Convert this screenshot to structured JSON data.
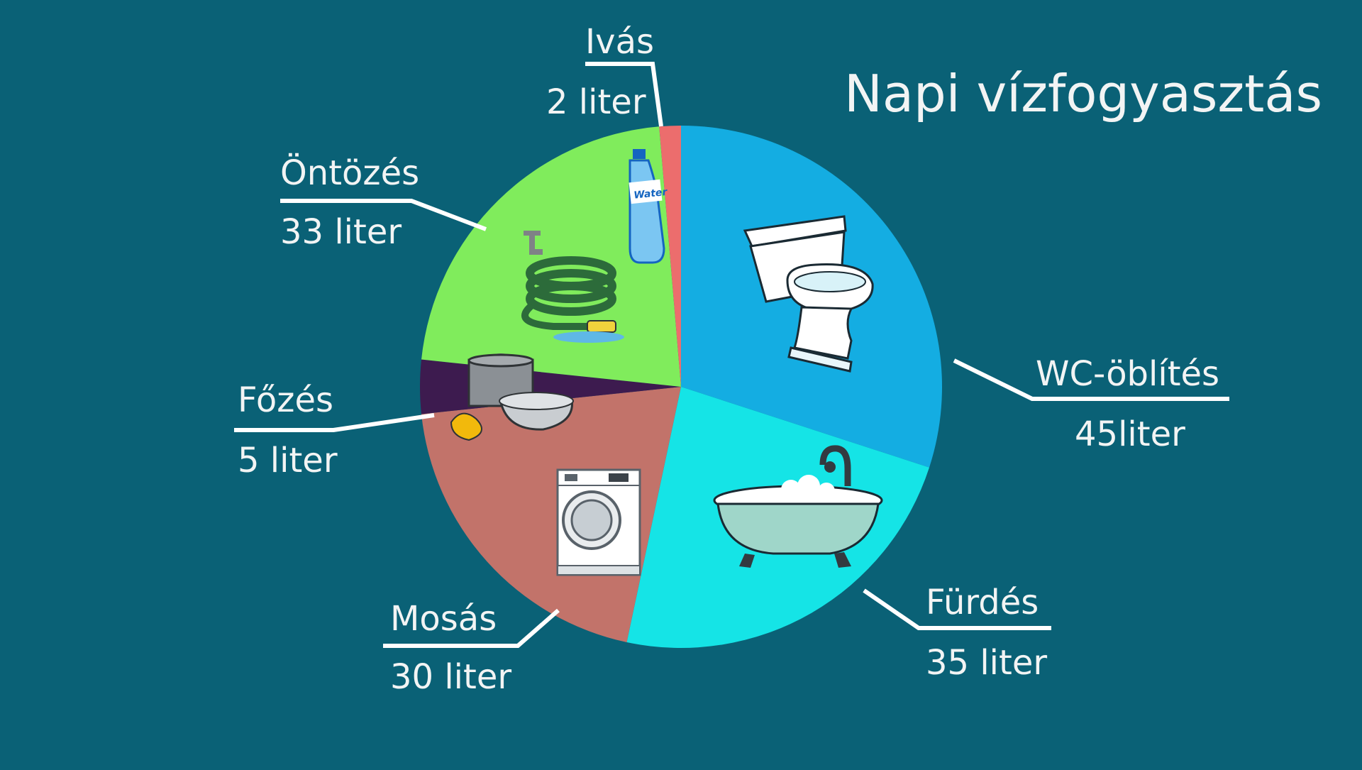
{
  "colors": {
    "background": "#0a6176",
    "text": "#f2f4f4",
    "leader": "#ffffff"
  },
  "title": "Napi vízfogyasztás",
  "chart_data": {
    "type": "pie",
    "title": "Napi vízfogyasztás",
    "start": "12 o'clock",
    "direction": "clockwise",
    "slices": [
      {
        "label": "WC-öblítés",
        "value_label": "45liter",
        "value": 45,
        "color": "#14ade2",
        "icon": "toilet-icon"
      },
      {
        "label": "Fürdés",
        "value_label": "35 liter",
        "value": 35,
        "color": "#15e4e6",
        "icon": "bathtub-icon"
      },
      {
        "label": "Mosás",
        "value_label": "30 liter",
        "value": 30,
        "color": "#c2736a",
        "icon": "washing-machine-icon"
      },
      {
        "label": "Főzés",
        "value_label": "5 liter",
        "value": 5,
        "color": "#3d1b4f",
        "icon": "cooking-pot-icon"
      },
      {
        "label": "Öntözés",
        "value_label": "33 liter",
        "value": 33,
        "color": "#80ec5c",
        "icon": "garden-hose-icon"
      },
      {
        "label": "Ivás",
        "value_label": "2 liter",
        "value": 2,
        "color": "#ec6d6d",
        "icon": "water-bottle-icon"
      }
    ]
  }
}
